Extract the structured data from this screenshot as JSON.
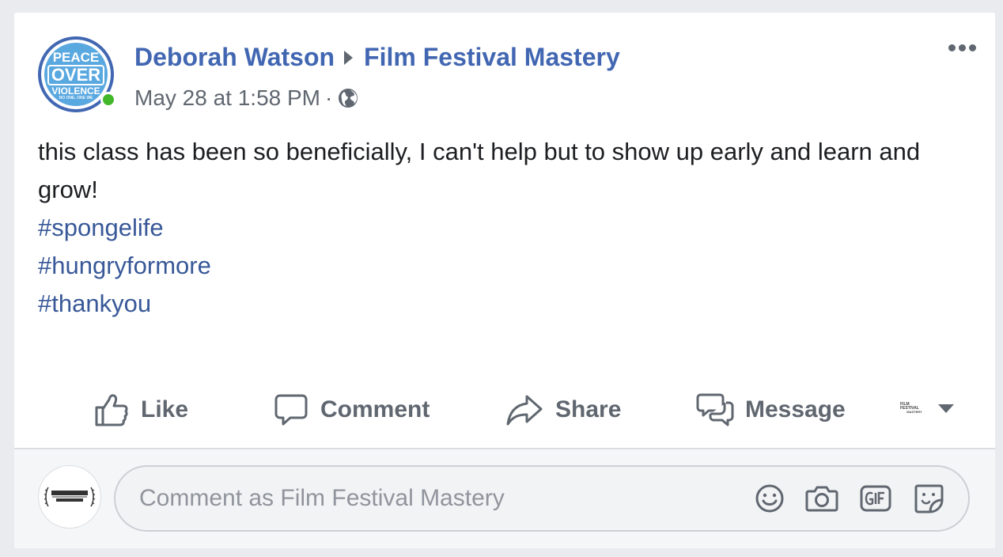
{
  "post": {
    "author": "Deborah Watson",
    "target": "Film Festival Mastery",
    "timestamp": "May 28 at 1:58 PM",
    "separator": "·",
    "privacy_icon": "globe-icon",
    "avatar": {
      "line1": "PEACE",
      "line2": "OVER",
      "line3": "VIOLENCE",
      "line4": "NO ONE. ONE WE"
    },
    "text": "this class has been so beneficially, I can't help but to show up early and learn and grow!",
    "hashtags": [
      "#spongelife",
      "#hungryformore",
      "#thankyou"
    ]
  },
  "actions": {
    "like": "Like",
    "comment": "Comment",
    "share": "Share",
    "message": "Message"
  },
  "page_selector": {
    "logo_line1": "FILM FESTIVAL",
    "logo_line2": "MASTERY"
  },
  "comment_box": {
    "placeholder": "Comment as Film Festival Mastery",
    "icons": [
      "emoji-icon",
      "camera-icon",
      "gif-icon",
      "sticker-icon"
    ]
  },
  "colors": {
    "link": "#4267b2",
    "hashtag": "#385898",
    "muted": "#606770",
    "online": "#42b72a"
  }
}
